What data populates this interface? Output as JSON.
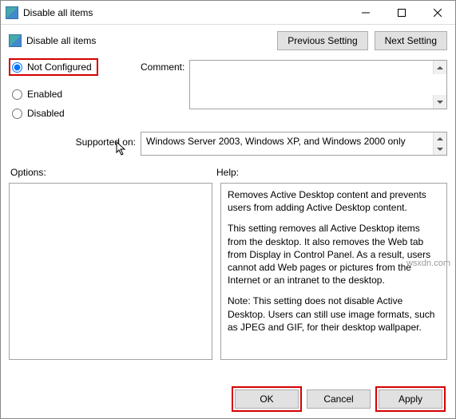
{
  "window": {
    "title": "Disable all items"
  },
  "header": {
    "label": "Disable all items",
    "prev": "Previous Setting",
    "next": "Next Setting"
  },
  "state": {
    "not_configured": "Not Configured",
    "enabled": "Enabled",
    "disabled": "Disabled"
  },
  "labels": {
    "comment": "Comment:",
    "supported": "Supported on:",
    "options": "Options:",
    "help": "Help:"
  },
  "supported_text": "Windows Server 2003, Windows XP, and Windows 2000 only",
  "help": {
    "p1": "Removes Active Desktop content and prevents users from adding Active Desktop content.",
    "p2": "This setting removes all Active Desktop items from the desktop. It also removes the Web tab from Display in Control Panel. As a result, users cannot add Web pages or  pictures from the Internet or an intranet to the desktop.",
    "p3": "Note: This setting does not disable Active Desktop. Users can  still use image formats, such as JPEG and GIF, for their desktop wallpaper."
  },
  "footer": {
    "ok": "OK",
    "cancel": "Cancel",
    "apply": "Apply"
  },
  "watermark": "wsxdn.com"
}
